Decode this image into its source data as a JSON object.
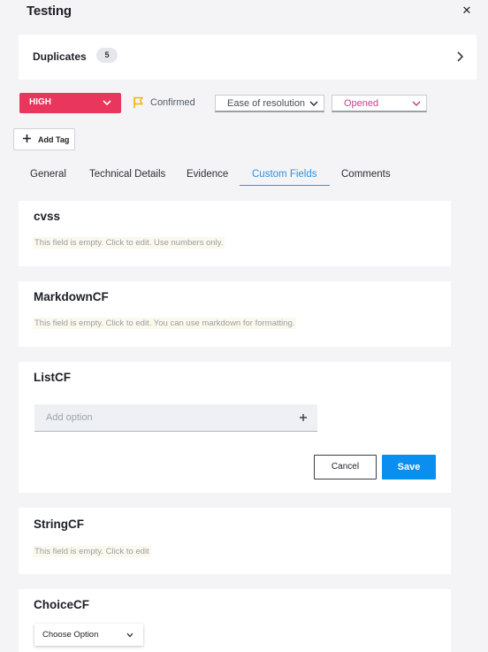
{
  "header": {
    "title": "Testing",
    "close_icon": "close-icon"
  },
  "duplicates": {
    "label": "Duplicates",
    "count": "5",
    "chevron_icon": "chevron-right-icon"
  },
  "status_row": {
    "severity": {
      "label": "HIGH",
      "color": "#e8365d"
    },
    "confirmed": {
      "label": "Confirmed",
      "icon": "flag-icon",
      "icon_color": "#f5b400"
    },
    "ease_dropdown": {
      "label": "Ease of resolution"
    },
    "status_dropdown": {
      "label": "Opened",
      "color": "#c0438a"
    }
  },
  "add_tag": {
    "label": "Add Tag"
  },
  "tabs": [
    {
      "label": "General",
      "active": false
    },
    {
      "label": "Technical Details",
      "active": false
    },
    {
      "label": "Evidence",
      "active": false
    },
    {
      "label": "Custom Fields",
      "active": true
    },
    {
      "label": "Comments",
      "active": false
    }
  ],
  "fields": {
    "cvss": {
      "title": "cvss",
      "empty_text": "This field is empty. Click to edit. Use numbers only."
    },
    "markdown": {
      "title": "MarkdownCF",
      "empty_text": "This field is empty. Click to edit. You can use markdown for formatting."
    },
    "list": {
      "title": "ListCF",
      "input_placeholder": "Add option",
      "cancel_label": "Cancel",
      "save_label": "Save",
      "save_color": "#0a8ef0"
    },
    "string": {
      "title": "StringCF",
      "empty_text": "This field is empty. Click to edit"
    },
    "choice": {
      "title": "ChoiceCF",
      "select_label": "Choose Option"
    }
  }
}
